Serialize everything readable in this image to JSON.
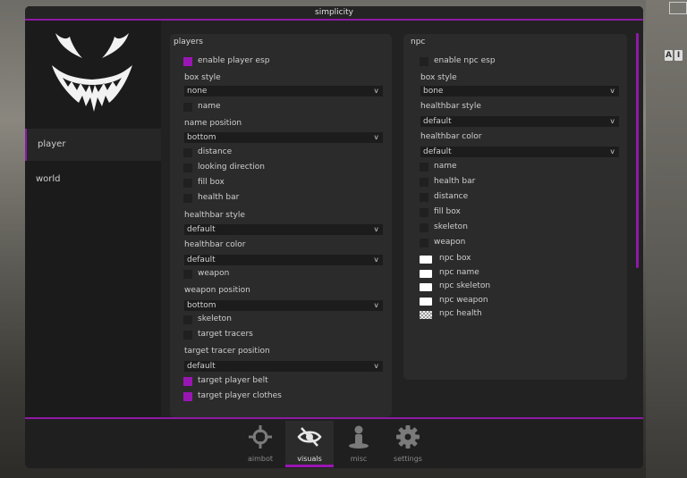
{
  "window": {
    "title": "simplicity"
  },
  "sidebar": {
    "items": [
      {
        "label": "player",
        "active": true
      },
      {
        "label": "world",
        "active": false
      }
    ]
  },
  "players": {
    "title": "players",
    "enable_esp": {
      "label": "enable player esp",
      "checked": true
    },
    "box_style": {
      "label": "box style",
      "value": "none"
    },
    "name": {
      "label": "name",
      "checked": false
    },
    "name_position": {
      "label": "name position",
      "value": "bottom"
    },
    "distance": {
      "label": "distance",
      "checked": false
    },
    "looking_direction": {
      "label": "looking direction",
      "checked": false
    },
    "fill_box": {
      "label": "fill box",
      "checked": false
    },
    "health_bar": {
      "label": "health bar",
      "checked": false
    },
    "healthbar_style": {
      "label": "healthbar style",
      "value": "default"
    },
    "healthbar_color": {
      "label": "healthbar color",
      "value": "default"
    },
    "weapon": {
      "label": "weapon",
      "checked": false
    },
    "weapon_position": {
      "label": "weapon position",
      "value": "bottom"
    },
    "skeleton": {
      "label": "skeleton",
      "checked": false
    },
    "target_tracers": {
      "label": "target tracers",
      "checked": false
    },
    "target_tracer_position": {
      "label": "target tracer position",
      "value": "default"
    },
    "target_player_belt": {
      "label": "target player belt",
      "checked": true
    },
    "target_player_clothes": {
      "label": "target player clothes",
      "checked": true
    }
  },
  "npc": {
    "title": "npc",
    "enable_esp": {
      "label": "enable npc esp",
      "checked": false
    },
    "box_style": {
      "label": "box style",
      "value": "bone"
    },
    "healthbar_style": {
      "label": "healthbar style",
      "value": "default"
    },
    "healthbar_color": {
      "label": "healthbar color",
      "value": "default"
    },
    "name": {
      "label": "name",
      "checked": false
    },
    "health_bar": {
      "label": "health bar",
      "checked": false
    },
    "distance": {
      "label": "distance",
      "checked": false
    },
    "fill_box": {
      "label": "fill box",
      "checked": false
    },
    "skeleton": {
      "label": "skeleton",
      "checked": false
    },
    "weapon": {
      "label": "weapon",
      "checked": false
    },
    "colors": [
      {
        "label": "npc box",
        "color": "#ffffff"
      },
      {
        "label": "npc name",
        "color": "#ffffff"
      },
      {
        "label": "npc skeleton",
        "color": "#ffffff"
      },
      {
        "label": "npc weapon",
        "color": "#ffffff"
      },
      {
        "label": "npc health",
        "color": "checkered"
      }
    ]
  },
  "dropdown_arrow": "v",
  "tabs": [
    {
      "label": "aimbot",
      "icon": "crosshair-icon",
      "active": false
    },
    {
      "label": "visuals",
      "icon": "eye-icon",
      "active": true
    },
    {
      "label": "misc",
      "icon": "person-icon",
      "active": false
    },
    {
      "label": "settings",
      "icon": "gear-icon",
      "active": false
    }
  ],
  "colors": {
    "accent": "#9a16b3",
    "panel": "#2b2b2b",
    "window": "#1b1b1b"
  },
  "background": {
    "keys": [
      "A",
      "I"
    ]
  }
}
